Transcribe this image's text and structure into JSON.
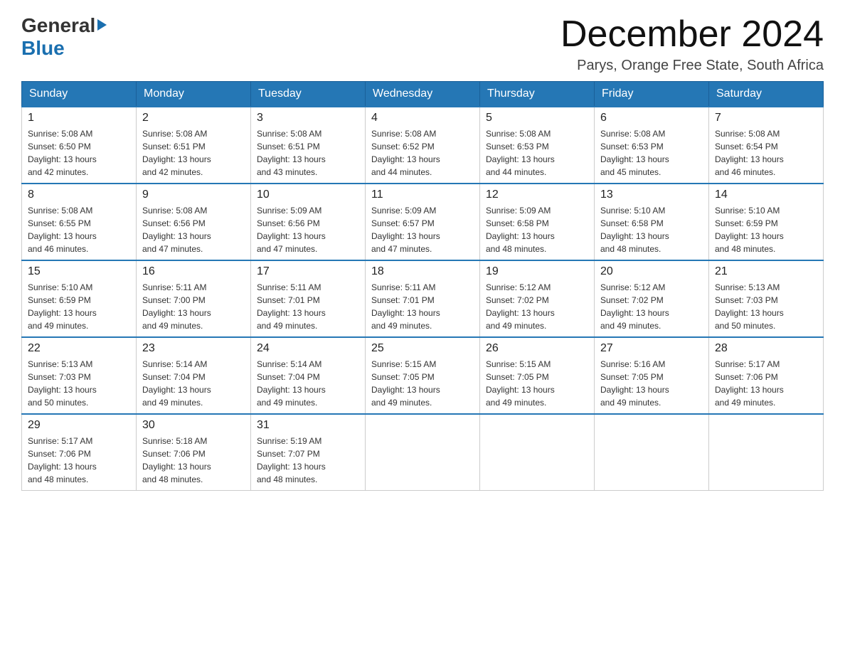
{
  "header": {
    "logo": {
      "general": "General",
      "blue": "Blue",
      "arrow": "▶"
    },
    "title": "December 2024",
    "location": "Parys, Orange Free State, South Africa"
  },
  "days_of_week": [
    "Sunday",
    "Monday",
    "Tuesday",
    "Wednesday",
    "Thursday",
    "Friday",
    "Saturday"
  ],
  "weeks": [
    [
      {
        "day": "1",
        "sunrise": "5:08 AM",
        "sunset": "6:50 PM",
        "daylight": "13 hours and 42 minutes."
      },
      {
        "day": "2",
        "sunrise": "5:08 AM",
        "sunset": "6:51 PM",
        "daylight": "13 hours and 42 minutes."
      },
      {
        "day": "3",
        "sunrise": "5:08 AM",
        "sunset": "6:51 PM",
        "daylight": "13 hours and 43 minutes."
      },
      {
        "day": "4",
        "sunrise": "5:08 AM",
        "sunset": "6:52 PM",
        "daylight": "13 hours and 44 minutes."
      },
      {
        "day": "5",
        "sunrise": "5:08 AM",
        "sunset": "6:53 PM",
        "daylight": "13 hours and 44 minutes."
      },
      {
        "day": "6",
        "sunrise": "5:08 AM",
        "sunset": "6:53 PM",
        "daylight": "13 hours and 45 minutes."
      },
      {
        "day": "7",
        "sunrise": "5:08 AM",
        "sunset": "6:54 PM",
        "daylight": "13 hours and 46 minutes."
      }
    ],
    [
      {
        "day": "8",
        "sunrise": "5:08 AM",
        "sunset": "6:55 PM",
        "daylight": "13 hours and 46 minutes."
      },
      {
        "day": "9",
        "sunrise": "5:08 AM",
        "sunset": "6:56 PM",
        "daylight": "13 hours and 47 minutes."
      },
      {
        "day": "10",
        "sunrise": "5:09 AM",
        "sunset": "6:56 PM",
        "daylight": "13 hours and 47 minutes."
      },
      {
        "day": "11",
        "sunrise": "5:09 AM",
        "sunset": "6:57 PM",
        "daylight": "13 hours and 47 minutes."
      },
      {
        "day": "12",
        "sunrise": "5:09 AM",
        "sunset": "6:58 PM",
        "daylight": "13 hours and 48 minutes."
      },
      {
        "day": "13",
        "sunrise": "5:10 AM",
        "sunset": "6:58 PM",
        "daylight": "13 hours and 48 minutes."
      },
      {
        "day": "14",
        "sunrise": "5:10 AM",
        "sunset": "6:59 PM",
        "daylight": "13 hours and 48 minutes."
      }
    ],
    [
      {
        "day": "15",
        "sunrise": "5:10 AM",
        "sunset": "6:59 PM",
        "daylight": "13 hours and 49 minutes."
      },
      {
        "day": "16",
        "sunrise": "5:11 AM",
        "sunset": "7:00 PM",
        "daylight": "13 hours and 49 minutes."
      },
      {
        "day": "17",
        "sunrise": "5:11 AM",
        "sunset": "7:01 PM",
        "daylight": "13 hours and 49 minutes."
      },
      {
        "day": "18",
        "sunrise": "5:11 AM",
        "sunset": "7:01 PM",
        "daylight": "13 hours and 49 minutes."
      },
      {
        "day": "19",
        "sunrise": "5:12 AM",
        "sunset": "7:02 PM",
        "daylight": "13 hours and 49 minutes."
      },
      {
        "day": "20",
        "sunrise": "5:12 AM",
        "sunset": "7:02 PM",
        "daylight": "13 hours and 49 minutes."
      },
      {
        "day": "21",
        "sunrise": "5:13 AM",
        "sunset": "7:03 PM",
        "daylight": "13 hours and 50 minutes."
      }
    ],
    [
      {
        "day": "22",
        "sunrise": "5:13 AM",
        "sunset": "7:03 PM",
        "daylight": "13 hours and 50 minutes."
      },
      {
        "day": "23",
        "sunrise": "5:14 AM",
        "sunset": "7:04 PM",
        "daylight": "13 hours and 49 minutes."
      },
      {
        "day": "24",
        "sunrise": "5:14 AM",
        "sunset": "7:04 PM",
        "daylight": "13 hours and 49 minutes."
      },
      {
        "day": "25",
        "sunrise": "5:15 AM",
        "sunset": "7:05 PM",
        "daylight": "13 hours and 49 minutes."
      },
      {
        "day": "26",
        "sunrise": "5:15 AM",
        "sunset": "7:05 PM",
        "daylight": "13 hours and 49 minutes."
      },
      {
        "day": "27",
        "sunrise": "5:16 AM",
        "sunset": "7:05 PM",
        "daylight": "13 hours and 49 minutes."
      },
      {
        "day": "28",
        "sunrise": "5:17 AM",
        "sunset": "7:06 PM",
        "daylight": "13 hours and 49 minutes."
      }
    ],
    [
      {
        "day": "29",
        "sunrise": "5:17 AM",
        "sunset": "7:06 PM",
        "daylight": "13 hours and 48 minutes."
      },
      {
        "day": "30",
        "sunrise": "5:18 AM",
        "sunset": "7:06 PM",
        "daylight": "13 hours and 48 minutes."
      },
      {
        "day": "31",
        "sunrise": "5:19 AM",
        "sunset": "7:07 PM",
        "daylight": "13 hours and 48 minutes."
      },
      null,
      null,
      null,
      null
    ]
  ],
  "labels": {
    "sunrise": "Sunrise:",
    "sunset": "Sunset:",
    "daylight": "Daylight:"
  }
}
